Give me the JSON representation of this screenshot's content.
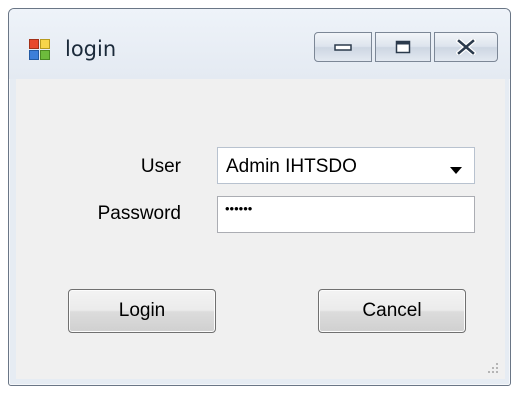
{
  "window": {
    "title": "login",
    "icon": "windows-form-icon",
    "controls": {
      "minimize": "minimize-icon",
      "maximize": "maximize-icon",
      "close": "close-icon"
    }
  },
  "form": {
    "user_label": "User",
    "user_value": "Admin IHTSDO",
    "password_label": "Password",
    "password_value": "••••••",
    "login_button": "Login",
    "cancel_button": "Cancel"
  },
  "colors": {
    "window_frame": "#e6ecf3",
    "client": "#f0f0f0"
  }
}
